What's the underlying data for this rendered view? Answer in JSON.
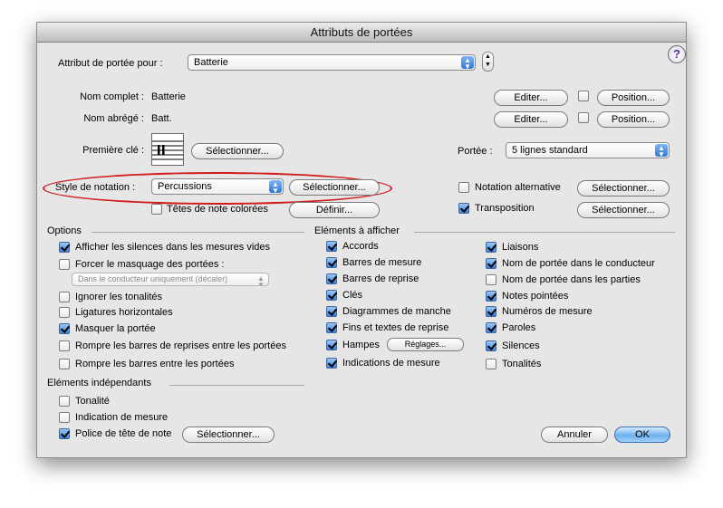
{
  "window": {
    "title": "Attributs de portées"
  },
  "header": {
    "label": "Attribut de portée pour :",
    "value": "Batterie"
  },
  "names": {
    "full_label": "Nom complet :",
    "full_value": "Batterie",
    "short_label": "Nom abrégé :",
    "short_value": "Batt.",
    "edit_label": "Editer...",
    "position_label": "Position..."
  },
  "clef": {
    "label": "Première clé :",
    "select_label": "Sélectionner..."
  },
  "staff": {
    "label": "Portée :",
    "value": "5 lignes standard"
  },
  "notation": {
    "label": "Style de notation :",
    "value": "Percussions",
    "select_label": "Sélectionner...",
    "colored_heads_label": "Têtes de note colorées",
    "define_label": "Définir...",
    "alt_notation_label": "Notation alternative",
    "transposition_label": "Transposition"
  },
  "options": {
    "title": "Options",
    "items": [
      {
        "label": "Afficher les silences dans les mesures vides",
        "checked": true
      },
      {
        "label": "Forcer le masquage des portées :",
        "checked": false
      },
      {
        "label": "Ignorer les tonalités",
        "checked": false
      },
      {
        "label": "Ligatures horizontales",
        "checked": false
      },
      {
        "label": "Masquer la portée",
        "checked": true
      },
      {
        "label": "Rompre les barres de reprises entre les portées",
        "checked": false
      },
      {
        "label": "Rompre les barres entre les portées",
        "checked": false
      }
    ],
    "masking_popup": "Dans le conducteur uniquement (décaler)"
  },
  "independent": {
    "title": "Eléments indépendants",
    "items": [
      {
        "label": "Tonalité",
        "checked": false
      },
      {
        "label": "Indication de mesure",
        "checked": false
      },
      {
        "label": "Police de tête de note",
        "checked": true
      }
    ],
    "select_label": "Sélectionner..."
  },
  "display": {
    "title": "Eléments à afficher",
    "col1": [
      {
        "label": "Accords",
        "checked": true
      },
      {
        "label": "Barres de mesure",
        "checked": true
      },
      {
        "label": "Barres de reprise",
        "checked": true
      },
      {
        "label": "Clés",
        "checked": true
      },
      {
        "label": "Diagrammes de manche",
        "checked": true
      },
      {
        "label": "Fins et textes de reprise",
        "checked": true
      },
      {
        "label": "Hampes",
        "checked": true
      },
      {
        "label": "Indications de mesure",
        "checked": true
      }
    ],
    "stems_settings_label": "Réglages...",
    "col2": [
      {
        "label": "Liaisons",
        "checked": true
      },
      {
        "label": "Nom de portée dans le conducteur",
        "checked": true
      },
      {
        "label": "Nom de portée dans les parties",
        "checked": false
      },
      {
        "label": "Notes pointées",
        "checked": true
      },
      {
        "label": "Numéros de mesure",
        "checked": true
      },
      {
        "label": "Paroles",
        "checked": true
      },
      {
        "label": "Silences",
        "checked": true
      },
      {
        "label": "Tonalités",
        "checked": false
      }
    ]
  },
  "footer": {
    "cancel_label": "Annuler",
    "ok_label": "OK"
  },
  "colors": {
    "highlight": "#d21d1d",
    "accent": "#3b7fd9"
  }
}
